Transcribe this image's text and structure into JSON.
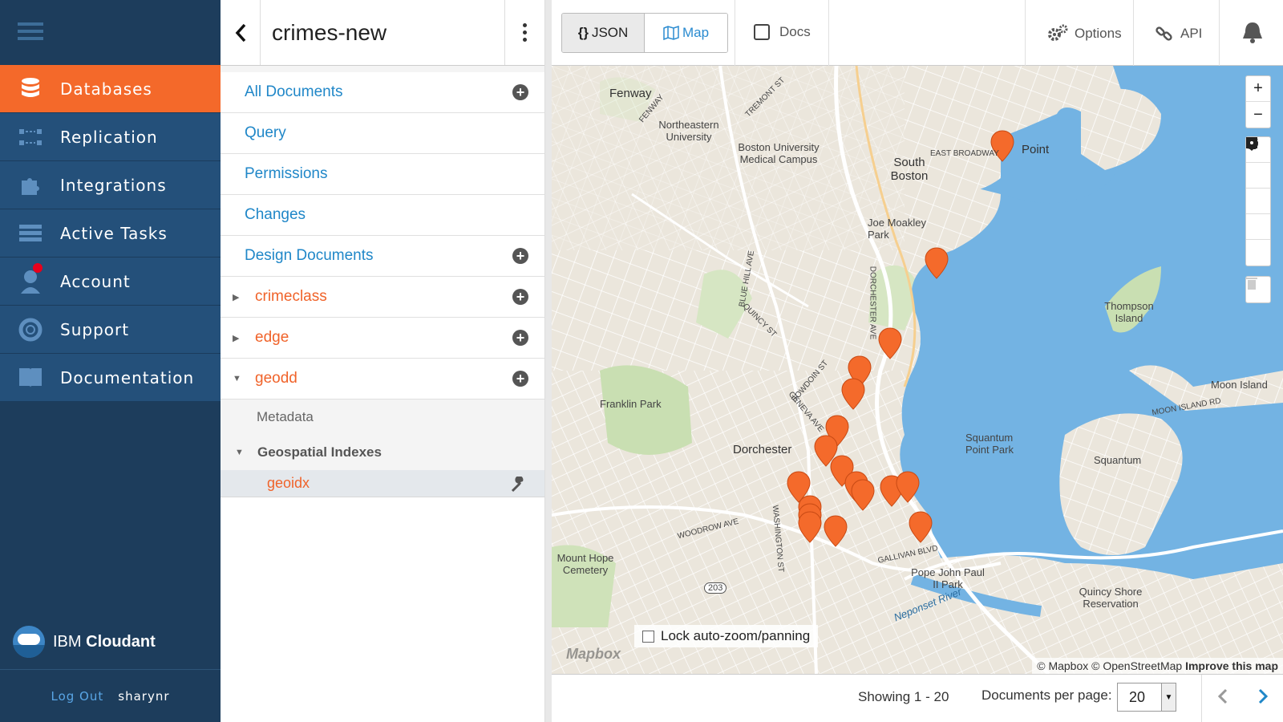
{
  "nav": {
    "items": [
      {
        "label": "Databases",
        "icon": "database-icon",
        "active": true
      },
      {
        "label": "Replication",
        "icon": "replication-icon"
      },
      {
        "label": "Integrations",
        "icon": "puzzle-icon"
      },
      {
        "label": "Active Tasks",
        "icon": "tasks-icon"
      },
      {
        "label": "Account",
        "icon": "user-icon",
        "notification": true
      },
      {
        "label": "Support",
        "icon": "lifebuoy-icon"
      },
      {
        "label": "Documentation",
        "icon": "book-icon"
      }
    ],
    "brand_prefix": "IBM",
    "brand_name": "Cloudant",
    "logout": "Log Out",
    "username": "sharynr"
  },
  "sidebar": {
    "db_name": "crimes-new",
    "links": [
      "All Documents",
      "Query",
      "Permissions",
      "Changes",
      "Design Documents"
    ],
    "design_docs": [
      "crimeclass",
      "edge",
      "geodd"
    ],
    "sub": {
      "metadata": "Metadata",
      "geo_header": "Geospatial Indexes",
      "geo_index": "geoidx"
    }
  },
  "toolbar": {
    "json_label": "JSON",
    "json_icon_text": "{}",
    "map_label": "Map",
    "docs_label": "Docs",
    "options_label": "Options",
    "api_label": "API"
  },
  "map": {
    "lock_label": "Lock auto-zoom/panning",
    "mapbox_logo": "Mapbox",
    "attr_mapbox": "© Mapbox",
    "attr_osm": "© OpenStreetMap",
    "attr_improve": "Improve this map",
    "zoom_in": "+",
    "zoom_out": "−",
    "labels": {
      "fenway": "Fenway",
      "northeastern": "Northeastern University",
      "bu": "Boston University Medical Campus",
      "south_boston": "South Boston",
      "point": "Point",
      "joe_moakley": "Joe Moakley Park",
      "thompson": "Thompson Island",
      "moon_island": "Moon Island",
      "moon_island_rd": "MOON ISLAND RD",
      "franklin_park": "Franklin Park",
      "dorchester": "Dorchester",
      "squantum_point": "Squantum Point Park",
      "squantum": "Squantum",
      "mount_hope": "Mount Hope Cemetery",
      "pope_john": "Pope John Paul II Park",
      "quincy_shore": "Quincy Shore Reservation",
      "neponset": "Neponset River",
      "east_broadway": "EAST BROADWAY",
      "dorchester_ave": "DORCHESTER AVE",
      "gallivan": "GALLIVAN BLVD",
      "washington_st": "WASHINGTON ST",
      "blue_hill": "BLUE HILL AVE",
      "woodrow": "WOODROW AVE",
      "route203": "203",
      "fenway_rd": "FENWAY",
      "tremont": "TREMONT ST",
      "geneva": "GENEVA AVE",
      "bowdoin": "BOWDOIN ST",
      "quincy_st": "QUINCY ST"
    }
  },
  "footer": {
    "showing": "Showing 1 - 20",
    "per_page_label": "Documents per page:",
    "per_page_value": "20"
  }
}
